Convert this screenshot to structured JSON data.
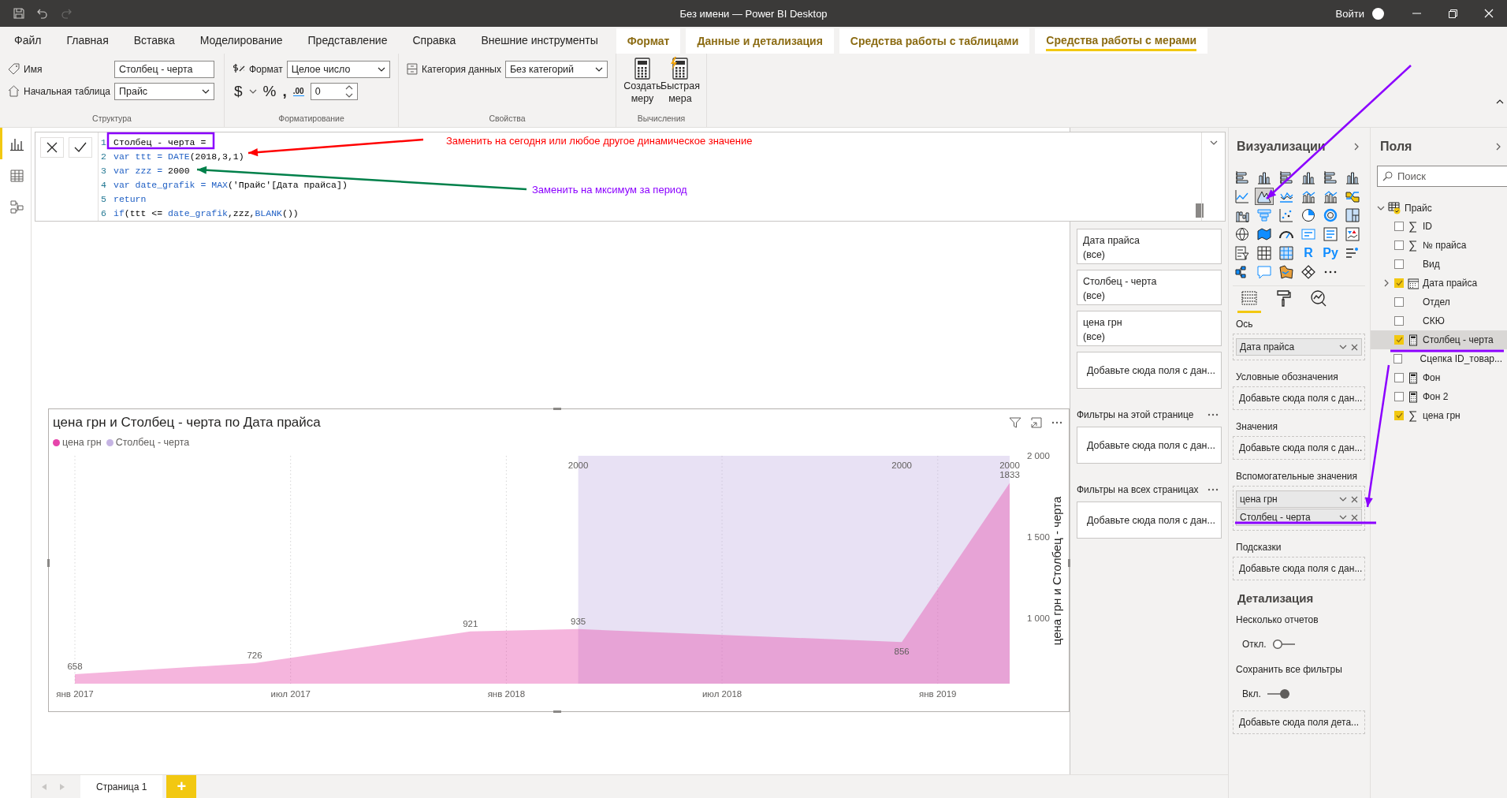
{
  "title_bar": {
    "title": "Без имени — Power BI Desktop",
    "sign_in": "Войти"
  },
  "ribbon_tabs": [
    {
      "label": "Файл",
      "kind": "main",
      "selected": false
    },
    {
      "label": "Главная",
      "kind": "main",
      "selected": false
    },
    {
      "label": "Вставка",
      "kind": "main",
      "selected": false
    },
    {
      "label": "Моделирование",
      "kind": "main",
      "selected": false
    },
    {
      "label": "Представление",
      "kind": "main",
      "selected": false
    },
    {
      "label": "Справка",
      "kind": "main",
      "selected": false
    },
    {
      "label": "Внешние инструменты",
      "kind": "main",
      "selected": false
    },
    {
      "label": "Формат",
      "kind": "context",
      "selected": false
    },
    {
      "label": "Данные и детализация",
      "kind": "context",
      "selected": false
    },
    {
      "label": "Средства работы с таблицами",
      "kind": "context",
      "selected": false
    },
    {
      "label": "Средства работы с мерами",
      "kind": "context",
      "selected": true
    }
  ],
  "ribbon": {
    "structure": {
      "title": "Структура",
      "name_label": "Имя",
      "name_value": "Столбец - черта",
      "home_table_label": "Начальная таблица",
      "home_table_value": "Прайс"
    },
    "formatting": {
      "title": "Форматирование",
      "format_label": "Формат",
      "format_value": "Целое число",
      "currency": "$",
      "percent": "%",
      "thousands": ",",
      "decimals": ".00",
      "decimal_places": "0"
    },
    "properties": {
      "title": "Свойства",
      "category_label": "Категория данных",
      "category_value": "Без категорий"
    },
    "calculations": {
      "title": "Вычисления",
      "buttons": [
        {
          "label": "Создать меру",
          "kind": "new"
        },
        {
          "label": "Быстрая мера",
          "kind": "quick"
        }
      ]
    }
  },
  "left_nav": [
    {
      "kind": "report",
      "selected": true
    },
    {
      "kind": "data",
      "selected": false
    },
    {
      "kind": "model",
      "selected": false
    }
  ],
  "formula_bar": {
    "lines": [
      {
        "number": "1",
        "tokens": [
          {
            "text": "Столбец - черта =",
            "kind": "plain"
          }
        ]
      },
      {
        "number": "2",
        "tokens": [
          {
            "text": "var ttt = ",
            "kind": "keyword"
          },
          {
            "text": "DATE",
            "kind": "function"
          },
          {
            "text": "(2018,3,1)",
            "kind": "plain"
          }
        ]
      },
      {
        "number": "3",
        "tokens": [
          {
            "text": "var zzz = ",
            "kind": "keyword"
          },
          {
            "text": "2000",
            "kind": "plain"
          }
        ]
      },
      {
        "number": "4",
        "tokens": [
          {
            "text": "var date_grafik = ",
            "kind": "keyword"
          },
          {
            "text": "MAX",
            "kind": "function"
          },
          {
            "text": "('Прайс'[Дата прайса])",
            "kind": "plain"
          }
        ]
      },
      {
        "number": "5",
        "tokens": [
          {
            "text": "return",
            "kind": "keyword"
          }
        ]
      },
      {
        "number": "6",
        "tokens": [
          {
            "text": "if",
            "kind": "keyword"
          },
          {
            "text": "(ttt <= ",
            "kind": "plain"
          },
          {
            "text": "date_grafik",
            "kind": "keyword"
          },
          {
            "text": ",zzz,",
            "kind": "plain"
          },
          {
            "text": "BLANK",
            "kind": "function"
          },
          {
            "text": "())",
            "kind": "plain"
          }
        ]
      }
    ]
  },
  "chart": {
    "chart_data": {
      "type": "area",
      "title": "цена грн и Столбец - черта по Дата прайса",
      "ylabel": "цена грн и Столбец - черта",
      "categories": [
        "янв 2017",
        null,
        null,
        null,
        null,
        null,
        "июл 2017",
        null,
        null,
        null,
        null,
        null,
        "янв 2018",
        null,
        null,
        null,
        null,
        null,
        "июл 2018",
        null,
        null,
        null,
        null,
        null,
        "янв 2019",
        null,
        null
      ],
      "ylim": [
        600,
        2000
      ],
      "yticks": [
        {
          "value": 1000,
          "label": "1 000"
        },
        {
          "value": 1500,
          "label": "1 500"
        },
        {
          "value": 2000,
          "label": "2 000"
        }
      ],
      "series": [
        {
          "name": "цена грн",
          "color": "#e645ab",
          "values": [
            658,
            null,
            null,
            null,
            null,
            726,
            null,
            null,
            null,
            null,
            null,
            921,
            null,
            null,
            935,
            null,
            null,
            null,
            null,
            null,
            null,
            null,
            null,
            856,
            null,
            null,
            1833
          ]
        },
        {
          "name": "Столбец - черта",
          "color": "#c5b4e3",
          "values": [
            null,
            null,
            null,
            null,
            null,
            null,
            null,
            null,
            null,
            null,
            null,
            null,
            null,
            null,
            2000,
            null,
            null,
            null,
            null,
            null,
            null,
            null,
            null,
            2000,
            null,
            null,
            2000
          ]
        }
      ],
      "data_labels": true,
      "grid": true
    }
  },
  "filters": {
    "visual_cards": [
      {
        "field": "Дата прайса",
        "value": "(все)"
      },
      {
        "field": "Столбец - черта",
        "value": "(все)"
      },
      {
        "field": "цена грн",
        "value": "(все)"
      }
    ],
    "visual_placeholder": "Добавьте сюда поля с дан...",
    "sections": [
      {
        "title": "Фильтры на этой странице",
        "placeholder": "Добавьте сюда поля с дан..."
      },
      {
        "title": "Фильтры на всех страницах",
        "placeholder": "Добавьте сюда поля с дан..."
      }
    ]
  },
  "visualizations": {
    "title": "Визуализации",
    "icons": [
      {
        "kind": "hbar",
        "selected": false
      },
      {
        "kind": "column",
        "selected": false
      },
      {
        "kind": "hbar",
        "selected": false
      },
      {
        "kind": "column",
        "selected": false
      },
      {
        "kind": "hbar",
        "selected": false
      },
      {
        "kind": "column",
        "selected": false
      },
      {
        "kind": "line",
        "selected": false
      },
      {
        "kind": "area",
        "selected": true
      },
      {
        "kind": "wave",
        "selected": false
      },
      {
        "kind": "combo",
        "selected": false
      },
      {
        "kind": "combo",
        "selected": false
      },
      {
        "kind": "ribbon",
        "selected": false
      },
      {
        "kind": "waterfall",
        "selected": false
      },
      {
        "kind": "funnel",
        "selected": false
      },
      {
        "kind": "scatter",
        "selected": false
      },
      {
        "kind": "pie",
        "selected": false
      },
      {
        "kind": "donut",
        "selected": false
      },
      {
        "kind": "treemap",
        "selected": false
      },
      {
        "kind": "globe",
        "selected": false
      },
      {
        "kind": "map",
        "selected": false
      },
      {
        "kind": "gauge",
        "selected": false
      },
      {
        "kind": "card",
        "selected": false
      },
      {
        "kind": "list",
        "selected": false
      },
      {
        "kind": "kpi",
        "selected": false
      },
      {
        "kind": "slicer",
        "selected": false
      },
      {
        "kind": "table",
        "selected": false
      },
      {
        "kind": "matrix",
        "selected": false
      },
      {
        "kind": "text",
        "label": "R",
        "selected": false
      },
      {
        "kind": "text",
        "label": "Py",
        "selected": false
      },
      {
        "kind": "influencers",
        "selected": false
      },
      {
        "kind": "tree",
        "selected": false
      },
      {
        "kind": "bubble",
        "selected": false
      },
      {
        "kind": "shape",
        "selected": false
      },
      {
        "kind": "diamond",
        "selected": false
      },
      {
        "kind": "more",
        "selected": false
      }
    ],
    "panes": [
      {
        "kind": "fields",
        "selected": true
      },
      {
        "kind": "format",
        "selected": false
      },
      {
        "kind": "analytics",
        "selected": false
      }
    ],
    "wells": [
      {
        "label": "Ось",
        "fields": [
          "Дата прайса"
        ]
      },
      {
        "label": "Условные обозначения",
        "placeholder": "Добавьте сюда поля с дан..."
      },
      {
        "label": "Значения",
        "placeholder": "Добавьте сюда поля с дан..."
      },
      {
        "label": "Вспомогательные значения",
        "fields": [
          "цена грн",
          "Столбец - черта"
        ]
      },
      {
        "label": "Подсказки",
        "placeholder": "Добавьте сюда поля с дан..."
      }
    ],
    "drillthrough": {
      "title": "Детализация",
      "toggles": [
        {
          "label": "Несколько отчетов",
          "state_text": "Откл.",
          "on": false
        },
        {
          "label": "Сохранить все фильтры",
          "state_text": "Вкл.",
          "on": true
        }
      ],
      "placeholder": "Добавьте сюда поля дета..."
    }
  },
  "fields": {
    "title": "Поля",
    "search_placeholder": "Поиск",
    "tables": [
      {
        "name": "Прайс",
        "expanded": true,
        "children": [
          {
            "label": "ID",
            "kind": "sum",
            "checked": false,
            "selected": false
          },
          {
            "label": "№ прайса",
            "kind": "sum",
            "checked": false,
            "selected": false
          },
          {
            "label": "Вид",
            "kind": "plain",
            "checked": false,
            "selected": false
          },
          {
            "label": "Дата прайса",
            "kind": "date",
            "checked": true,
            "selected": false,
            "expanded": false
          },
          {
            "label": "Отдел",
            "kind": "plain",
            "checked": false,
            "selected": false
          },
          {
            "label": "СКЮ",
            "kind": "plain",
            "checked": false,
            "selected": false
          },
          {
            "label": "Столбец - черта",
            "kind": "measure",
            "checked": true,
            "selected": true
          },
          {
            "label": "Сцепка ID_товар...",
            "kind": "plain",
            "checked": false,
            "selected": false
          },
          {
            "label": "Фон",
            "kind": "measure",
            "checked": false,
            "selected": false
          },
          {
            "label": "Фон 2",
            "kind": "measure",
            "checked": false,
            "selected": false
          },
          {
            "label": "цена грн",
            "kind": "sum",
            "checked": true,
            "selected": false
          }
        ]
      }
    ]
  },
  "page_tabs": [
    {
      "label": "Страница 1",
      "selected": true
    }
  ],
  "add_page": "+",
  "annotations": [
    {
      "kind": "box",
      "color": "#8b00ff"
    },
    {
      "kind": "arrow",
      "color": "#ff0000"
    },
    {
      "kind": "note",
      "color": "#ff0000",
      "text": "Заменить на сегодня или любое другое динамическое значение"
    },
    {
      "kind": "arrow",
      "color": "#00804a"
    },
    {
      "kind": "note",
      "color": "#8b00ff",
      "text": "Заменить на мксимум за период"
    },
    {
      "kind": "arrow",
      "color": "#8b00ff"
    },
    {
      "kind": "arrow",
      "color": "#8b00ff"
    },
    {
      "kind": "line",
      "color": "#8b00ff"
    },
    {
      "kind": "line",
      "color": "#8b00ff"
    }
  ]
}
